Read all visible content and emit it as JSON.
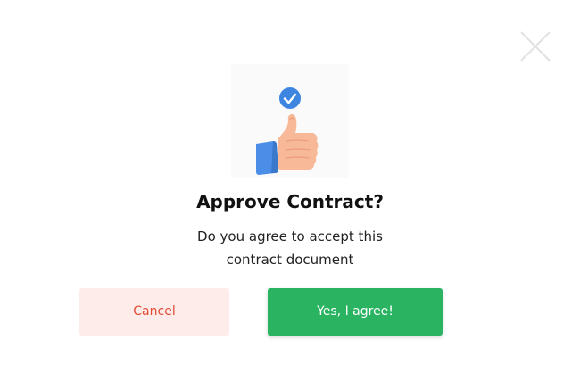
{
  "dialog": {
    "title": "Approve Contract?",
    "message_line1": "Do you agree to accept this",
    "message_line2": "contract document"
  },
  "icons": {
    "close": "close-icon",
    "illustration": "thumbs-up-check-illustration"
  },
  "buttons": {
    "cancel_label": "Cancel",
    "confirm_label": "Yes, I agree!"
  },
  "colors": {
    "confirm_bg": "#2ab462",
    "cancel_bg": "#fdece9",
    "cancel_text": "#e34b33",
    "check_badge": "#3d85e0",
    "sleeve": "#4a8ee8",
    "skin": "#f8b999"
  }
}
